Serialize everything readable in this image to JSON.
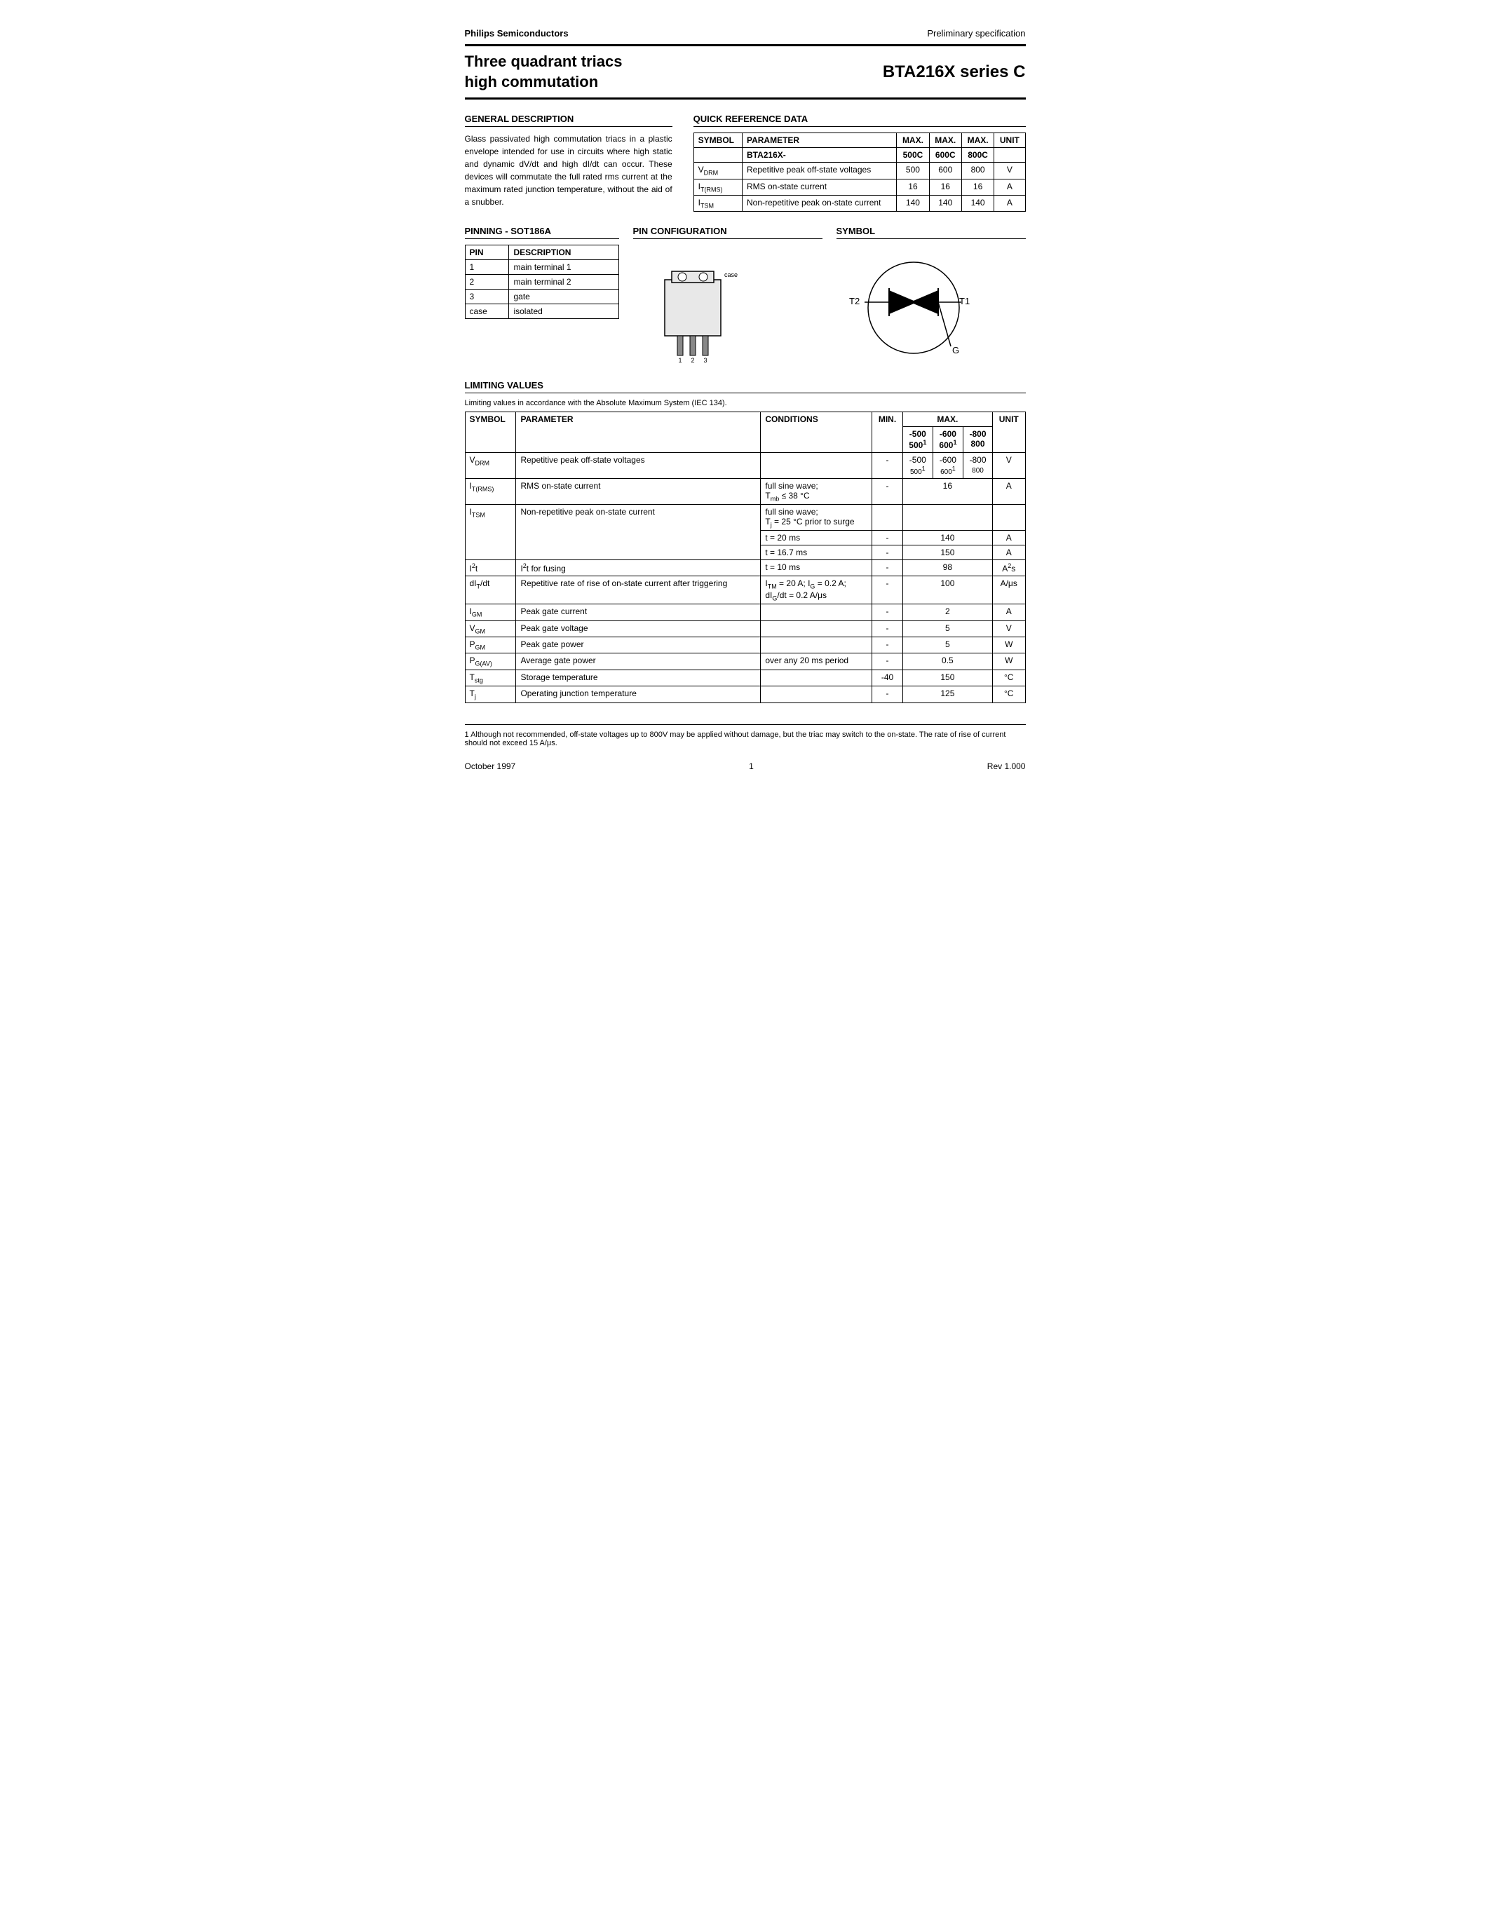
{
  "header": {
    "company": "Philips Semiconductors",
    "spec_type": "Preliminary specification",
    "main_title": "Three quadrant triacs\nhigh commutation",
    "part_number": "BTA216X series C"
  },
  "general_description": {
    "title": "GENERAL DESCRIPTION",
    "text": "Glass passivated high commutation triacs in a plastic envelope intended for use in circuits where high static and dynamic dV/dt and high dI/dt can occur. These devices will commutate the full rated rms current at the maximum rated junction temperature, without the aid of a snubber."
  },
  "quick_reference": {
    "title": "QUICK REFERENCE DATA",
    "columns": [
      "SYMBOL",
      "PARAMETER",
      "MAX.",
      "MAX.",
      "MAX.",
      "UNIT"
    ],
    "sub_header": [
      "",
      "BTA216X-",
      "500C",
      "600C",
      "800C",
      ""
    ],
    "rows": [
      [
        "V_DRM",
        "Repetitive peak off-state voltages",
        "500",
        "600",
        "800",
        "V"
      ],
      [
        "I_T(RMS)",
        "RMS on-state current",
        "16",
        "16",
        "16",
        "A"
      ],
      [
        "I_TSM",
        "Non-repetitive peak on-state current",
        "140",
        "140",
        "140",
        "A"
      ]
    ]
  },
  "pinning": {
    "title": "PINNING - SOT186A",
    "columns": [
      "PIN",
      "DESCRIPTION"
    ],
    "rows": [
      [
        "1",
        "main terminal 1"
      ],
      [
        "2",
        "main terminal 2"
      ],
      [
        "3",
        "gate"
      ],
      [
        "case",
        "isolated"
      ]
    ]
  },
  "pin_configuration": {
    "title": "PIN CONFIGURATION"
  },
  "symbol_section": {
    "title": "SYMBOL"
  },
  "limiting_values": {
    "title": "LIMITING VALUES",
    "sub_note": "Limiting values in accordance with the Absolute Maximum System (IEC 134).",
    "columns": [
      "SYMBOL",
      "PARAMETER",
      "CONDITIONS",
      "MIN.",
      "MAX.",
      "",
      "",
      "UNIT"
    ],
    "sub_cols": [
      "-500\n500¹",
      "-600\n600¹",
      "-800\n800"
    ],
    "rows": [
      {
        "symbol": "V_DRM",
        "parameter": "Repetitive peak off-state voltages",
        "conditions": "",
        "min": "-",
        "max_500": "-500\n500¹",
        "max_600": "-600\n600¹",
        "max_800": "-800\n800",
        "unit": "V"
      },
      {
        "symbol": "I_T(RMS)",
        "parameter": "RMS on-state current",
        "conditions": "full sine wave;\nT_mb ≤ 38 °C",
        "min": "-",
        "max_mid": "16",
        "unit": "A"
      },
      {
        "symbol": "I_TSM",
        "parameter": "Non-repetitive peak on-state current",
        "conditions": "full sine wave;\nT_j = 25 °C prior to surge",
        "min": "-",
        "max_mid": "",
        "unit": ""
      },
      {
        "symbol": "",
        "parameter": "",
        "conditions": "t = 20 ms",
        "min": "-",
        "max_mid": "140",
        "unit": "A"
      },
      {
        "symbol": "",
        "parameter": "",
        "conditions": "t = 16.7 ms",
        "min": "-",
        "max_mid": "150",
        "unit": "A"
      },
      {
        "symbol": "I²t",
        "parameter": "I²t for fusing",
        "conditions": "t = 10 ms",
        "min": "-",
        "max_mid": "98",
        "unit": "A²s"
      },
      {
        "symbol": "dI_T/dt",
        "parameter": "Repetitive rate of rise of on-state current after triggering",
        "conditions": "I_TM = 20 A; I_G = 0.2 A;\ndI_G/dt = 0.2 A/μs",
        "min": "-",
        "max_mid": "100",
        "unit": "A/μs"
      },
      {
        "symbol": "I_GM",
        "parameter": "Peak gate current",
        "conditions": "",
        "min": "-",
        "max_mid": "2",
        "unit": "A"
      },
      {
        "symbol": "V_GM",
        "parameter": "Peak gate voltage",
        "conditions": "",
        "min": "-",
        "max_mid": "5",
        "unit": "V"
      },
      {
        "symbol": "P_GM",
        "parameter": "Peak gate power",
        "conditions": "",
        "min": "-",
        "max_mid": "5",
        "unit": "W"
      },
      {
        "symbol": "P_G(AV)",
        "parameter": "Average gate power",
        "conditions": "over any 20 ms period",
        "min": "-",
        "max_mid": "0.5",
        "unit": "W"
      },
      {
        "symbol": "T_stg",
        "parameter": "Storage temperature",
        "conditions": "",
        "min": "-40",
        "max_mid": "150",
        "unit": "°C"
      },
      {
        "symbol": "T_j",
        "parameter": "Operating junction temperature",
        "conditions": "",
        "min": "-",
        "max_mid": "125",
        "unit": "°C"
      }
    ]
  },
  "footnote": "1  Although not recommended, off-state voltages up to 800V may be applied without damage, but the triac may switch to the on-state. The rate of rise of current should not exceed 15 A/μs.",
  "footer": {
    "date": "October 1997",
    "page": "1",
    "rev": "Rev 1.000"
  }
}
